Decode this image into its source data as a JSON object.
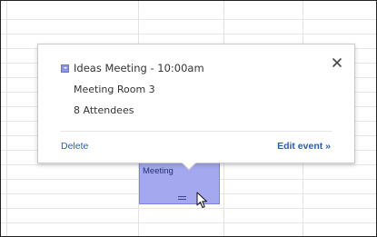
{
  "calendar": {
    "event_block": {
      "label": "Meeting",
      "color": "#a4a9ef"
    }
  },
  "popup": {
    "title": "Ideas Meeting - 10:00am",
    "location": "Meeting Room 3",
    "attendees": "8 Attendees",
    "color_swatch": "#8e94ec",
    "close_icon": "close-icon",
    "delete_label": "Delete",
    "edit_label": "Edit event »"
  },
  "colors": {
    "link": "#2a5db0",
    "grid_line": "#e6e6e6"
  }
}
